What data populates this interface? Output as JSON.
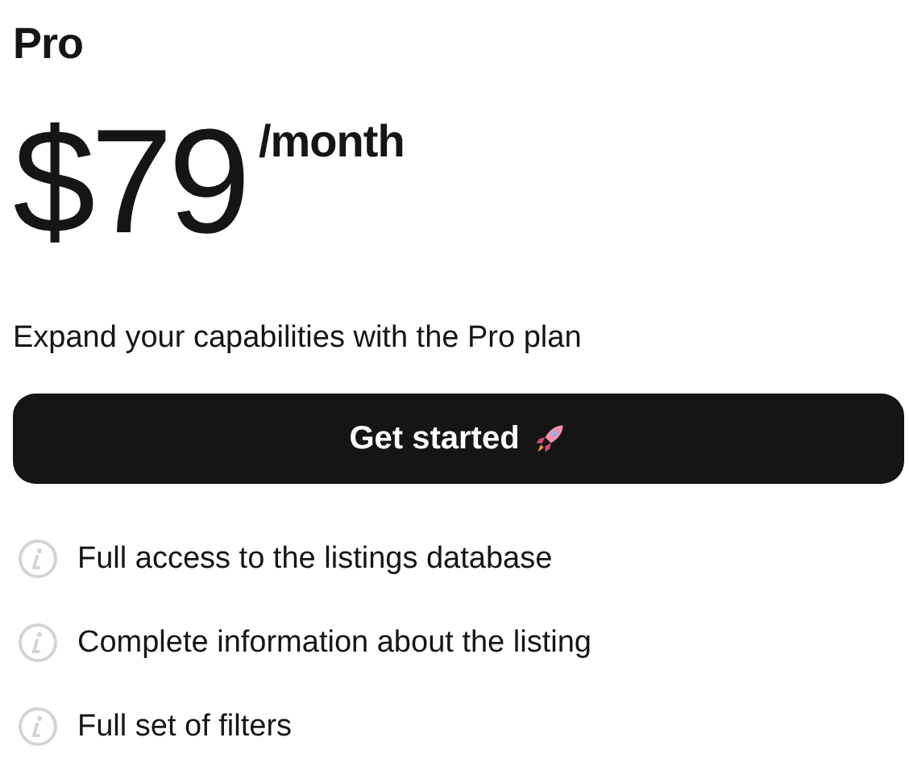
{
  "plan": {
    "name": "Pro",
    "price": "$79",
    "period": "/month",
    "description": "Expand your capabilities with the Pro plan"
  },
  "button": {
    "label": "Get started"
  },
  "features": [
    {
      "text": "Full access to the listings database"
    },
    {
      "text": "Complete information about the listing"
    },
    {
      "text": "Full set of filters"
    }
  ]
}
